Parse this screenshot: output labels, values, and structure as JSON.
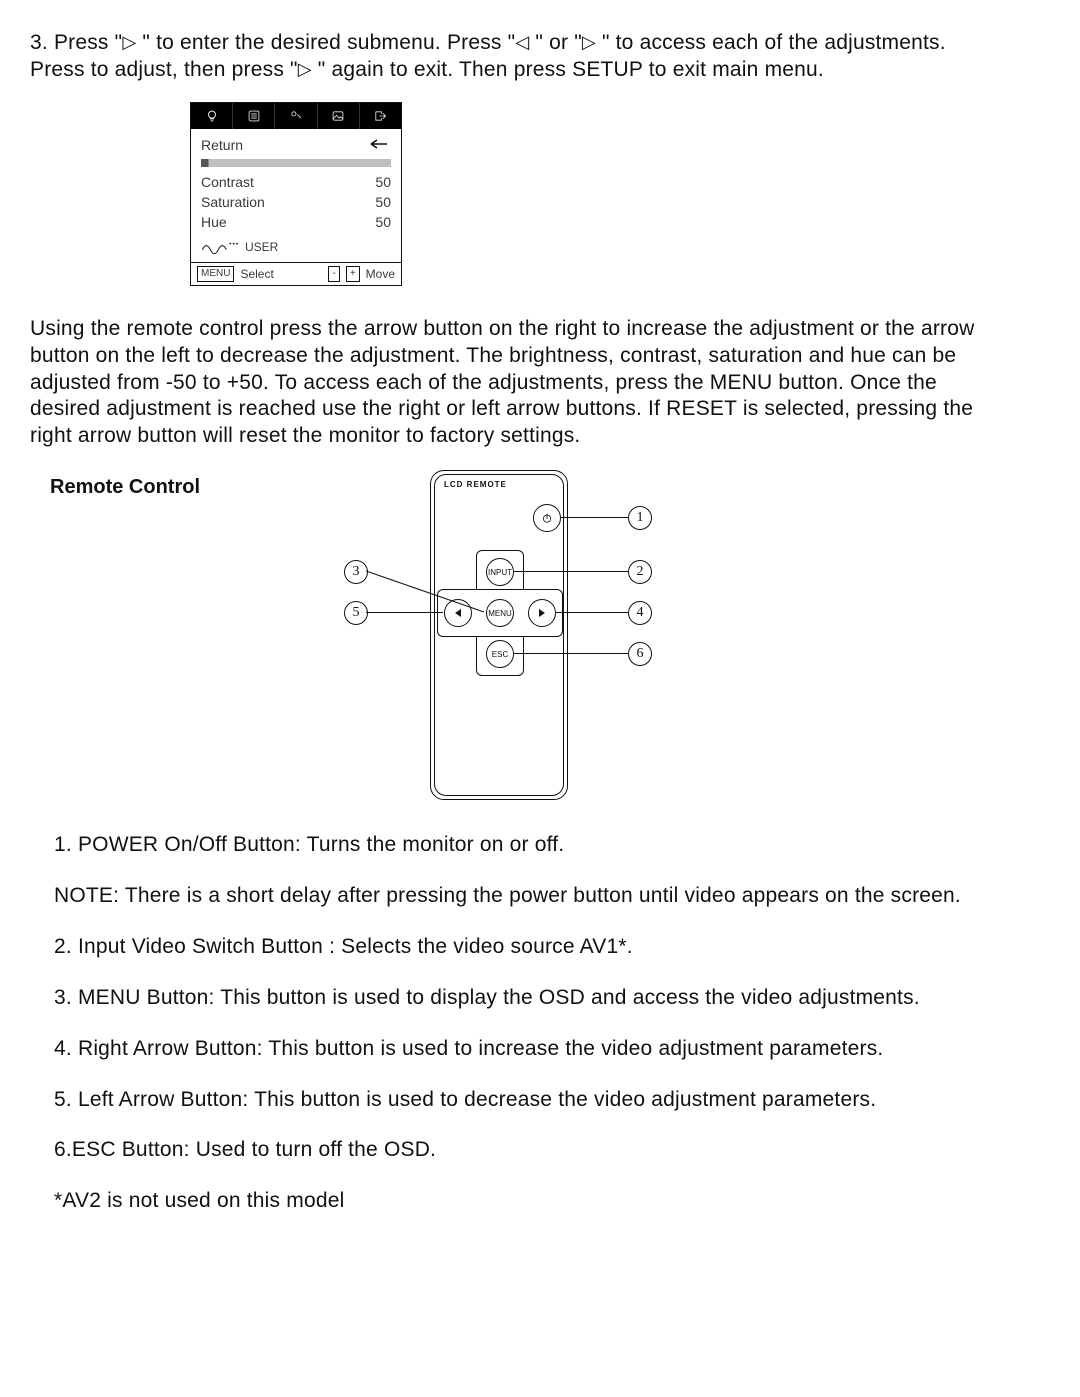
{
  "intro3": {
    "prefix": "3. Press \"",
    "mid1": " \" to enter the desired submenu. Press \"",
    "mid2": " \" or \"",
    "mid3": " \"  to access each of the adjustments. Press to adjust, then press \"",
    "suffix": " \" again to exit. Then press SETUP to exit main menu."
  },
  "osd": {
    "return": "Return",
    "rows": [
      {
        "label": "Contrast",
        "value": "50"
      },
      {
        "label": "Saturation",
        "value": "50"
      },
      {
        "label": "Hue",
        "value": "50"
      }
    ],
    "user": "USER",
    "menu": "MENU",
    "select": "Select",
    "minus": "-",
    "plus": "+",
    "move": "Move"
  },
  "para2": "Using the remote control press the arrow button on the right to increase the adjustment or the arrow button on the left to decrease the adjustment.  The brightness, contrast, saturation and hue can be adjusted from -50 to +50. To access each of the adjustments, press the MENU button.  Once the desired adjustment is reached use the right or left arrow buttons. If RESET is selected, pressing the right arrow button will reset the monitor to factory settings.",
  "rc": {
    "title": "Remote Control",
    "label": "LCD REMOTE",
    "buttons": {
      "input": "INPUT",
      "menu": "MENU",
      "esc": "ESC"
    },
    "callouts": [
      "1",
      "2",
      "3",
      "4",
      "5",
      "6"
    ]
  },
  "defs": {
    "d1": "1. POWER On/Off Button:  Turns the monitor on or off.",
    "note": "NOTE: There is a short delay after pressing the power button until video appears on the screen.",
    "d2": "2. Input Video Switch Button :  Selects the video source AV1*.",
    "d3": "3.  MENU Button: This button is used to display the OSD and access the video adjustments.",
    "d4": "4. Right Arrow Button: This button is used to increase the video adjustment parameters.",
    "d5": "5. Left Arrow Button: This button is used to decrease  the video adjustment parameters.",
    "d6": "6.ESC Button: Used to turn off the OSD.",
    "foot": "*AV2 is not used on this model"
  }
}
